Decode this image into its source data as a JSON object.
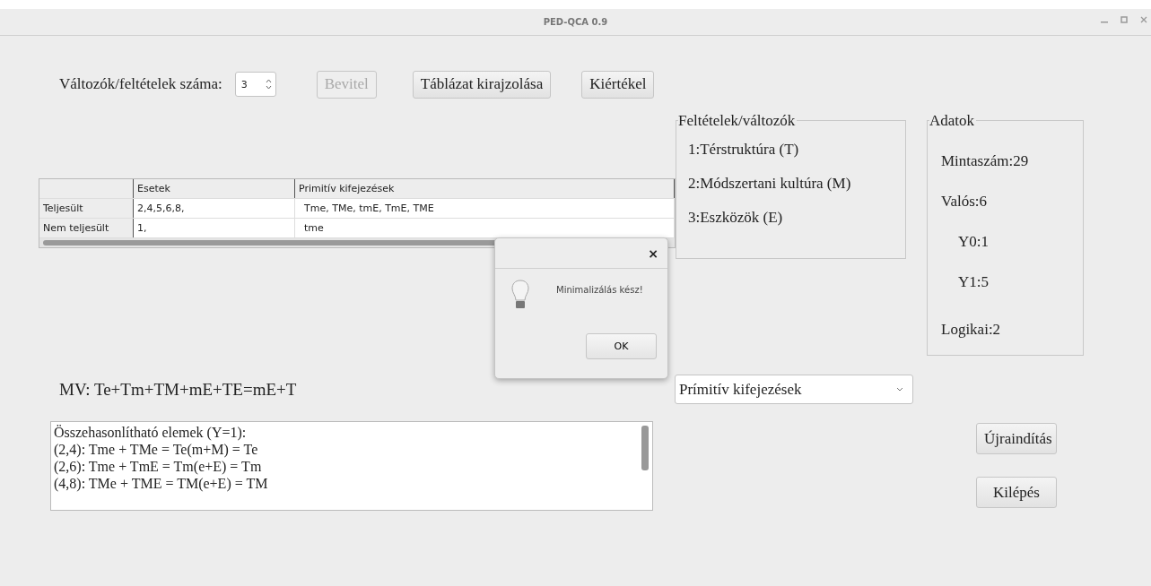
{
  "window": {
    "title": "PED-QCA 0.9"
  },
  "toolbar": {
    "count_label": "Változók/feltételek száma:",
    "count_value": "3",
    "buttons": [
      {
        "label": "Bevitel",
        "disabled": true
      },
      {
        "label": "Táblázat kirajzolása",
        "disabled": false
      },
      {
        "label": "Kiértékel",
        "disabled": false
      }
    ]
  },
  "table": {
    "columns": [
      "Esetek",
      "Primitív kifejezések"
    ],
    "rows": [
      {
        "header": "Teljesült",
        "cells": [
          "2,4,5,6,8,",
          "Tme, TMe, tmE, TmE, TME"
        ]
      },
      {
        "header": "Nem teljesült",
        "cells": [
          "1,",
          "tme"
        ]
      }
    ]
  },
  "conditions": {
    "title": "Feltételek/változók",
    "items": [
      "1:Térstruktúra (T)",
      "2:Módszertani kultúra (M)",
      "3:Eszközök (E)"
    ]
  },
  "data": {
    "title": "Adatok",
    "items": [
      {
        "kind": "main",
        "text": "Mintaszám:29"
      },
      {
        "kind": "main",
        "text": "Valós:6"
      },
      {
        "kind": "sub",
        "text": "Y0:1"
      },
      {
        "kind": "sub",
        "text": "Y1:5"
      },
      {
        "kind": "main",
        "text": "Logikai:2"
      }
    ]
  },
  "dialog": {
    "close": "×",
    "message": "Minimalizálás kész!",
    "button": "OK"
  },
  "result": "MV: Te+Tm+TM+mE+TE=mE+T",
  "dropdown": {
    "value": "Prímitív kifejezések"
  },
  "log": [
    "Összehasonlítható elemek (Y=1):",
    "(2,4): Tme + TMe = Te(m+M) = Te",
    "(2,6): Tme + TmE = Tm(e+E) = Tm",
    "(4,8): TMe + TME = TM(e+E) = TM"
  ],
  "actions": [
    "Újraindítás",
    "Kilépés"
  ]
}
